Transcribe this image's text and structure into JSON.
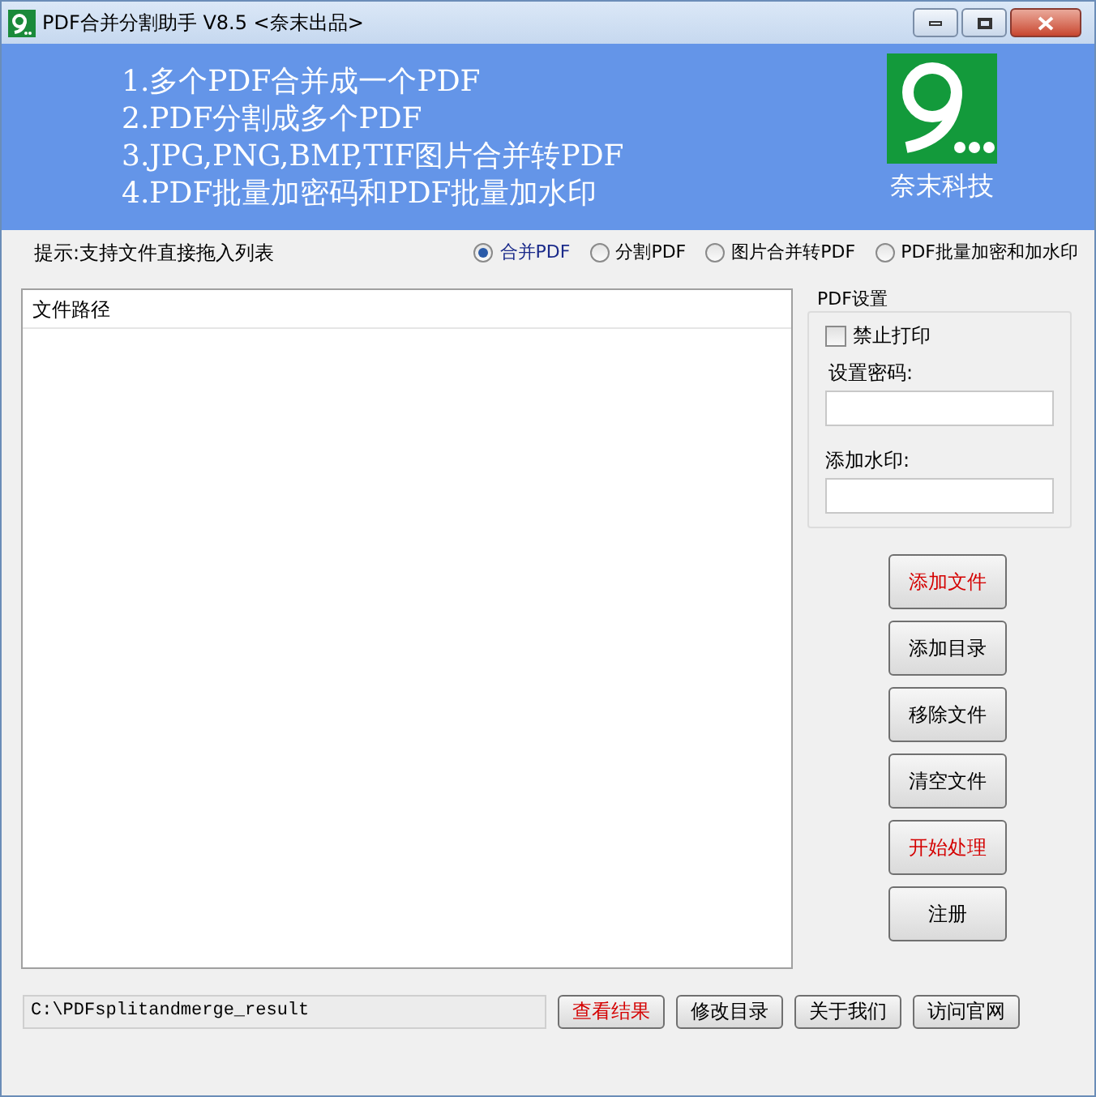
{
  "window": {
    "title": "PDF合并分割助手 V8.5 <奈末出品>"
  },
  "banner": {
    "lines": [
      "1.多个PDF合并成一个PDF",
      "2.PDF分割成多个PDF",
      "3.JPG,PNG,BMP,TIF图片合并转PDF",
      "4.PDF批量加密码和PDF批量加水印"
    ],
    "brand": "奈末科技"
  },
  "hint": "提示:支持文件直接拖入列表",
  "modes": [
    {
      "label": "合并PDF",
      "selected": true
    },
    {
      "label": "分割PDF",
      "selected": false
    },
    {
      "label": "图片合并转PDF",
      "selected": false
    },
    {
      "label": "PDF批量加密和加水印",
      "selected": false
    }
  ],
  "file_list": {
    "columns": [
      "文件路径"
    ]
  },
  "pdf_settings": {
    "title": "PDF设置",
    "no_print": {
      "label": "禁止打印",
      "checked": false
    },
    "password_label": "设置密码:",
    "watermark_label": "添加水印:"
  },
  "actions": [
    {
      "label": "添加文件",
      "kind": "accent"
    },
    {
      "label": "添加目录",
      "kind": "normal"
    },
    {
      "label": "移除文件",
      "kind": "normal"
    },
    {
      "label": "清空文件",
      "kind": "normal"
    },
    {
      "label": "开始处理",
      "kind": "accent"
    },
    {
      "label": "注册",
      "kind": "normal"
    }
  ],
  "output": {
    "path": "C:\\PDFsplitandmerge_result"
  },
  "footer_buttons": [
    {
      "label": "查看结果",
      "kind": "accent"
    },
    {
      "label": "修改目录",
      "kind": "normal"
    },
    {
      "label": "关于我们",
      "kind": "normal"
    },
    {
      "label": "访问官网",
      "kind": "normal"
    }
  ]
}
